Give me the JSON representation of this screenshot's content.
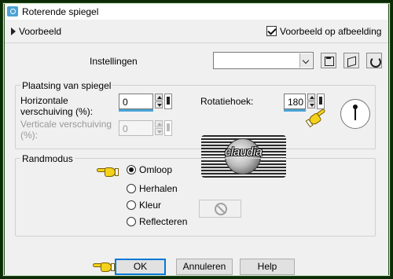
{
  "window": {
    "title": "Roterende spiegel",
    "preview_label": "Voorbeeld",
    "preview_on_image_label": "Voorbeeld op afbeelding",
    "preview_on_image_checked": true
  },
  "settings": {
    "label": "Instellingen",
    "preset_value": ""
  },
  "mirror_placement": {
    "group_label": "Plaatsing van spiegel",
    "horizontal_label": "Horizontale verschuiving (%):",
    "horizontal_value": "0",
    "vertical_label": "Verticale verschuiving (%):",
    "vertical_value": "0",
    "vertical_enabled": false,
    "rotation_label": "Rotatiehoek:",
    "rotation_value": "180"
  },
  "edge_mode": {
    "group_label": "Randmodus",
    "options": [
      {
        "label": "Omloop",
        "selected": true
      },
      {
        "label": "Herhalen",
        "selected": false
      },
      {
        "label": "Kleur",
        "selected": false
      },
      {
        "label": "Reflecteren",
        "selected": false
      }
    ]
  },
  "watermark": {
    "text": "claudia"
  },
  "buttons": {
    "ok": "OK",
    "cancel": "Annuleren",
    "help": "Help"
  },
  "icons": {
    "app": "app-icon",
    "save": "save-preset-icon",
    "randomize": "cube-icon",
    "reset": "reset-icon",
    "pointer": "pointing-hand-icon",
    "color_disabled": "no-color-icon"
  },
  "colors": {
    "frame": "#1f4a16",
    "accent": "#0078d7",
    "spin_underline": "#4aa3d6",
    "hand": "#f5d21a"
  }
}
